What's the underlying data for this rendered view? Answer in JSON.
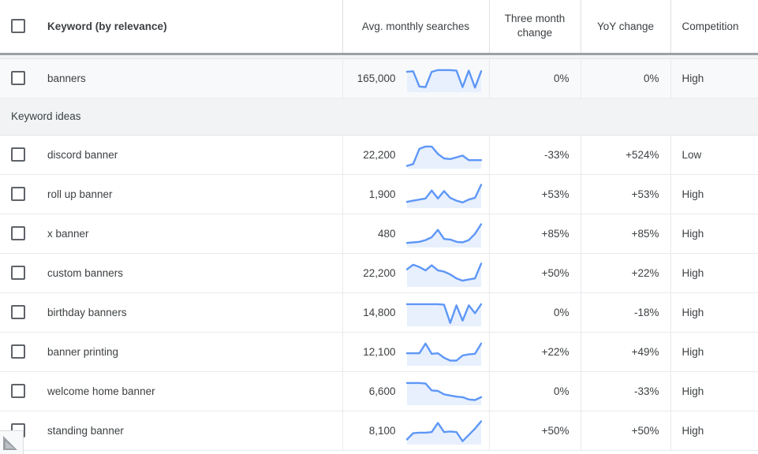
{
  "table": {
    "columns": [
      {
        "key": "select",
        "label": ""
      },
      {
        "key": "keyword",
        "label": "Keyword (by relevance)"
      },
      {
        "key": "avg",
        "label": "Avg. monthly searches"
      },
      {
        "key": "three_mo",
        "label": "Three month change"
      },
      {
        "key": "yoy",
        "label": "YoY change"
      },
      {
        "key": "comp",
        "label": "Competition"
      }
    ],
    "column_labels": {
      "keyword": "Keyword (by relevance)",
      "avg": "Avg. monthly searches",
      "three_month_line1": "Three month",
      "three_month_line2": "change",
      "yoy": "YoY change",
      "competition": "Competition"
    },
    "section_label": "Keyword ideas",
    "seed_row": {
      "keyword": "banners",
      "avg_monthly_searches": "165,000",
      "three_month_change": "0%",
      "yoy_change": "0%",
      "competition": "High",
      "trend": [
        72,
        74,
        20,
        18,
        72,
        78,
        78,
        78,
        76,
        18,
        76,
        16,
        74
      ]
    },
    "rows": [
      {
        "keyword": "discord banner",
        "avg_monthly_searches": "22,200",
        "three_month_change": "-33%",
        "yoy_change": "+524%",
        "competition": "Low",
        "trend": [
          10,
          16,
          70,
          78,
          78,
          52,
          36,
          34,
          40,
          46,
          30,
          30,
          30
        ]
      },
      {
        "keyword": "roll up banner",
        "avg_monthly_searches": "1,900",
        "three_month_change": "+53%",
        "yoy_change": "+53%",
        "competition": "High",
        "trend": [
          22,
          26,
          30,
          34,
          62,
          34,
          60,
          36,
          26,
          20,
          30,
          36,
          82
        ]
      },
      {
        "keyword": "x banner",
        "avg_monthly_searches": "480",
        "three_month_change": "+85%",
        "yoy_change": "+85%",
        "competition": "High",
        "trend": [
          16,
          18,
          20,
          26,
          36,
          62,
          30,
          28,
          20,
          18,
          26,
          48,
          82
        ]
      },
      {
        "keyword": "custom banners",
        "avg_monthly_searches": "22,200",
        "three_month_change": "+50%",
        "yoy_change": "+22%",
        "competition": "High",
        "trend": [
          62,
          78,
          70,
          58,
          76,
          58,
          54,
          44,
          30,
          22,
          26,
          30,
          82
        ]
      },
      {
        "keyword": "birthday banners",
        "avg_monthly_searches": "14,800",
        "three_month_change": "0%",
        "yoy_change": "-18%",
        "competition": "High",
        "trend": [
          78,
          78,
          78,
          78,
          78,
          78,
          76,
          12,
          74,
          20,
          74,
          46,
          78
        ]
      },
      {
        "keyword": "banner printing",
        "avg_monthly_searches": "12,100",
        "three_month_change": "+22%",
        "yoy_change": "+49%",
        "competition": "High",
        "trend": [
          44,
          44,
          44,
          78,
          42,
          44,
          28,
          18,
          18,
          36,
          40,
          42,
          78
        ]
      },
      {
        "keyword": "welcome home banner",
        "avg_monthly_searches": "6,600",
        "three_month_change": "0%",
        "yoy_change": "-33%",
        "competition": "High",
        "trend": [
          78,
          78,
          78,
          76,
          52,
          50,
          38,
          34,
          30,
          28,
          20,
          18,
          28
        ]
      },
      {
        "keyword": "standing banner",
        "avg_monthly_searches": "8,100",
        "three_month_change": "+50%",
        "yoy_change": "+50%",
        "competition": "High",
        "trend": [
          18,
          40,
          42,
          42,
          44,
          76,
          44,
          46,
          44,
          12,
          34,
          56,
          82
        ]
      }
    ]
  },
  "colors": {
    "spark_line": "#5e97f6",
    "spark_fill": "#e8f0fe",
    "header_text": "#3c4043",
    "row_border": "#e8eaed",
    "section_bg": "#f1f3f4",
    "seed_bg": "#f8f9fa",
    "checkbox_border": "#5f6368"
  },
  "resize_grip": {
    "icon": "resize-grip-icon"
  }
}
